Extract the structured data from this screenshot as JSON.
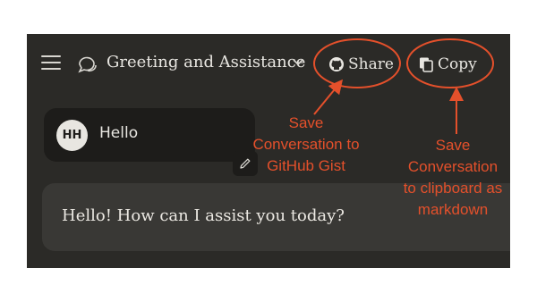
{
  "header": {
    "conversation_title": "Greeting and Assistance",
    "share_label": "Share",
    "copy_label": "Copy"
  },
  "messages": {
    "user_initials": "HH",
    "user_message": "Hello",
    "assistant_message": "Hello! How can I assist you today?"
  },
  "annotations": {
    "share_note": [
      "Save",
      "Conversation to",
      "GitHub Gist"
    ],
    "copy_note": [
      "Save",
      "Conversation",
      "to clipboard as",
      "markdown"
    ]
  },
  "colors": {
    "app_background": "#2b2a27",
    "annotation_red": "#e4502b",
    "text": "#e8e6e1"
  },
  "icons": [
    "menu-icon",
    "chat-icon",
    "chevron-down-icon",
    "github-icon",
    "copy-icon",
    "pencil-icon"
  ]
}
